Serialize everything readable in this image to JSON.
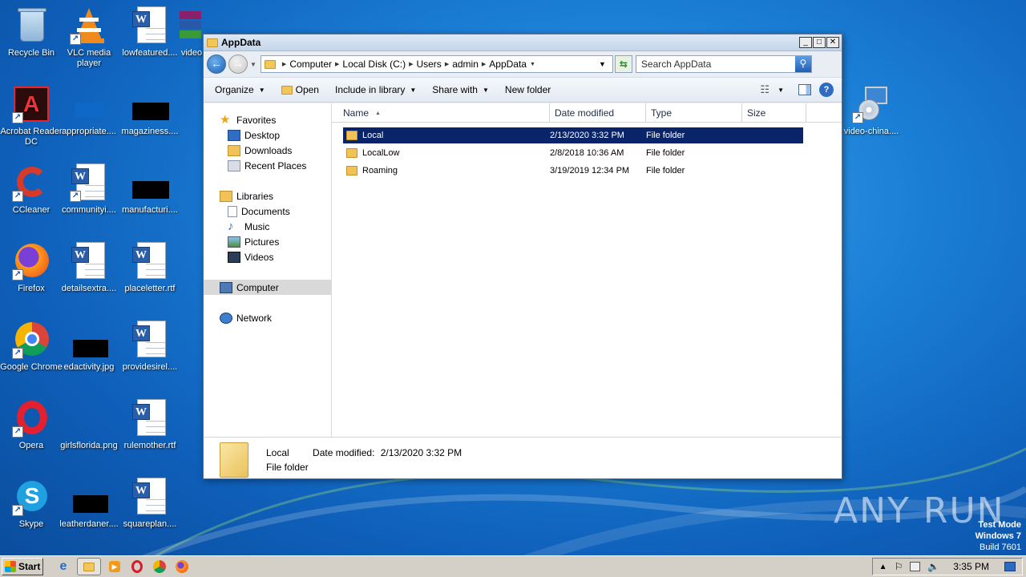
{
  "desktop": {
    "icons": [
      {
        "label": "Recycle Bin"
      },
      {
        "label": "VLC media player"
      },
      {
        "label": "lowfeatured...."
      },
      {
        "label": "video"
      },
      {
        "label": "Acrobat Reader DC"
      },
      {
        "label": "appropriate...."
      },
      {
        "label": "magaziness...."
      },
      {
        "label": "CCleaner"
      },
      {
        "label": "communityi...."
      },
      {
        "label": "manufacturi...."
      },
      {
        "label": "Firefox"
      },
      {
        "label": "detailsextra...."
      },
      {
        "label": "placeletter.rtf"
      },
      {
        "label": "Google Chrome"
      },
      {
        "label": "edactivity.jpg"
      },
      {
        "label": "providesirel...."
      },
      {
        "label": "Opera"
      },
      {
        "label": "girlsflorida.png"
      },
      {
        "label": "rulemother.rtf"
      },
      {
        "label": "Skype"
      },
      {
        "label": "leatherdaner...."
      },
      {
        "label": "squareplan...."
      },
      {
        "label": "video-china...."
      }
    ]
  },
  "window": {
    "title": "AppData",
    "buttons": {
      "minimize": "_",
      "maximize": "□",
      "close": "✕"
    },
    "address": {
      "crumbs": [
        "Computer",
        "Local Disk (C:)",
        "Users",
        "admin",
        "AppData"
      ]
    },
    "search": {
      "placeholder": "Search AppData"
    },
    "toolbar": {
      "organize": "Organize",
      "open": "Open",
      "include": "Include in library",
      "share": "Share with",
      "newfolder": "New folder",
      "help": "?"
    },
    "nav": {
      "favorites": "Favorites",
      "desktop": "Desktop",
      "downloads": "Downloads",
      "recent": "Recent Places",
      "libraries": "Libraries",
      "documents": "Documents",
      "music": "Music",
      "pictures": "Pictures",
      "videos": "Videos",
      "computer": "Computer",
      "network": "Network"
    },
    "columns": {
      "name": "Name",
      "date": "Date modified",
      "type": "Type",
      "size": "Size"
    },
    "files": [
      {
        "name": "Local",
        "date": "2/13/2020 3:32 PM",
        "type": "File folder"
      },
      {
        "name": "LocalLow",
        "date": "2/8/2018 10:36 AM",
        "type": "File folder"
      },
      {
        "name": "Roaming",
        "date": "3/19/2019 12:34 PM",
        "type": "File folder"
      }
    ],
    "details": {
      "name": "Local",
      "date_label": "Date modified:",
      "date": "2/13/2020 3:32 PM",
      "type": "File folder"
    }
  },
  "taskbar": {
    "start": "Start",
    "clock": "3:35 PM"
  },
  "watermark": {
    "line1": "Test Mode",
    "line2": "Windows 7",
    "line3": "Build 7601",
    "brand": "ANY RUN"
  },
  "colors": {
    "selection": "#0a246a",
    "desktop": "#1b7fd6"
  }
}
